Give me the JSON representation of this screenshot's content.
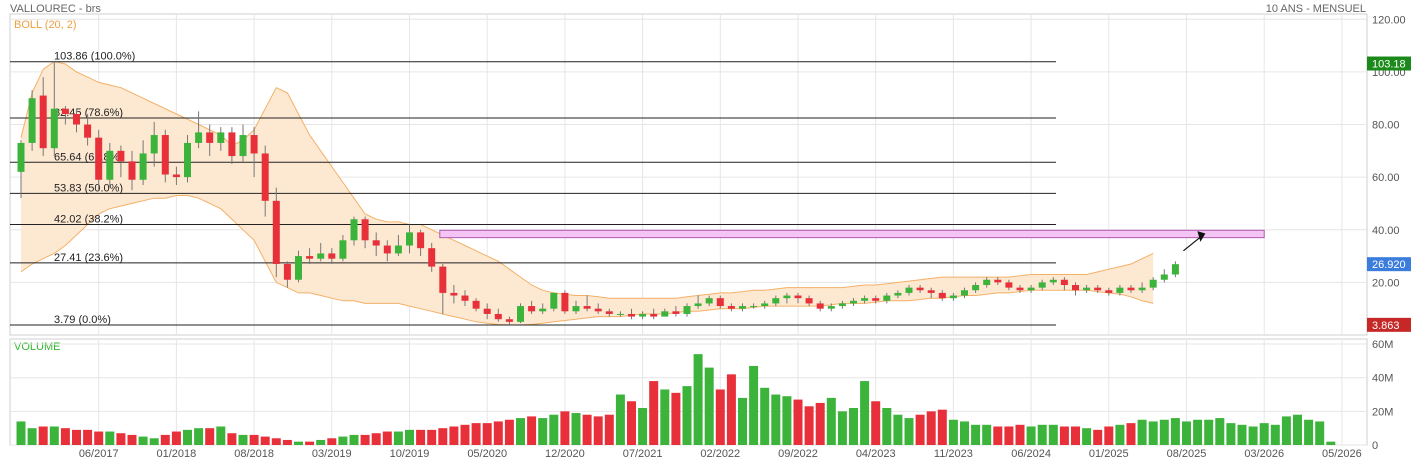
{
  "header": {
    "title": "VALLOUREC - brs",
    "period": "10 ANS - MENSUEL",
    "indicator": "BOLL (20, 2)",
    "volume_label": "VOLUME"
  },
  "colors": {
    "up": "#3cb43c",
    "down": "#e8303a",
    "band_fill": "#fde9d2",
    "band_line": "#f3b067",
    "grid": "#e6e6e6",
    "zone_fill": "#f4c4f4",
    "zone_border": "#b05ab0",
    "high_badge": "#1b8a1b",
    "last_badge": "#3b7ddd",
    "low_badge": "#c62828"
  },
  "chart_data": {
    "type": "candlestick",
    "price_axis": {
      "ticks": [
        "120.00",
        "100.00",
        "80.00",
        "60.00",
        "40.00",
        "20.00"
      ],
      "values": [
        120,
        100,
        80,
        60,
        40,
        20
      ],
      "range": [
        0,
        122
      ]
    },
    "volume_axis": {
      "ticks": [
        "60M",
        "40M",
        "20M",
        "0"
      ],
      "values": [
        60,
        40,
        20,
        0
      ],
      "range": [
        0,
        63
      ]
    },
    "x_labels": [
      "06/2017",
      "01/2018",
      "08/2018",
      "03/2019",
      "10/2019",
      "05/2020",
      "12/2020",
      "07/2021",
      "02/2022",
      "09/2022",
      "04/2023",
      "11/2023",
      "06/2024",
      "01/2025",
      "08/2025",
      "03/2026",
      "05/2026"
    ],
    "x_label_index": [
      7,
      14,
      21,
      28,
      35,
      42,
      49,
      56,
      63,
      70,
      77,
      84,
      91,
      98,
      105,
      112,
      119
    ],
    "fib_levels": [
      {
        "label": "103.86  (100.0%)",
        "price": 103.86
      },
      {
        "label": "82.45  (78.6%)",
        "price": 82.45
      },
      {
        "label": "65.64  (61.8%)",
        "price": 65.64
      },
      {
        "label": "53.83  (50.0%)",
        "price": 53.83
      },
      {
        "label": "42.02  (38.2%)",
        "price": 42.02
      },
      {
        "label": "27.41  (23.6%)",
        "price": 27.41
      },
      {
        "label": "3.79  (0.0%)",
        "price": 3.79
      }
    ],
    "badges": [
      {
        "label": "103.18",
        "price": 103.18,
        "kind": "high"
      },
      {
        "label": "26.920",
        "price": 26.92,
        "kind": "last"
      },
      {
        "label": "3.863",
        "price": 3.863,
        "kind": "low"
      }
    ],
    "resistance_zone": {
      "low": 37.0,
      "high": 39.8,
      "from_index": 38,
      "to_index": 112
    },
    "candles": [
      [
        62,
        73,
        52,
        74
      ],
      [
        73,
        90,
        70,
        93
      ],
      [
        91,
        71,
        68,
        98
      ],
      [
        71,
        86,
        68,
        104
      ],
      [
        86,
        84,
        80,
        87
      ],
      [
        84,
        80,
        77,
        86
      ],
      [
        80,
        75,
        72,
        84
      ],
      [
        75,
        59,
        55,
        78
      ],
      [
        59,
        70,
        56,
        73
      ],
      [
        70,
        66,
        60,
        72
      ],
      [
        66,
        59,
        55,
        70
      ],
      [
        59,
        69,
        57,
        74
      ],
      [
        69,
        76,
        64,
        81
      ],
      [
        76,
        61,
        58,
        78
      ],
      [
        61,
        60,
        57,
        64
      ],
      [
        60,
        73,
        58,
        76
      ],
      [
        73,
        77,
        71,
        85
      ],
      [
        77,
        73,
        68,
        80
      ],
      [
        73,
        77,
        70,
        79
      ],
      [
        77,
        68,
        65,
        79
      ],
      [
        68,
        76,
        66,
        80
      ],
      [
        76,
        69,
        60,
        79
      ],
      [
        69,
        51,
        45,
        72
      ],
      [
        51,
        27,
        22,
        56
      ],
      [
        27,
        21,
        18,
        28
      ],
      [
        21,
        30,
        20,
        32
      ],
      [
        30,
        29,
        27,
        33
      ],
      [
        29,
        31,
        28,
        35
      ],
      [
        31,
        29,
        27,
        33
      ],
      [
        29,
        36,
        28,
        38
      ],
      [
        36,
        44,
        34,
        45
      ],
      [
        44,
        36,
        33,
        45
      ],
      [
        36,
        34,
        30,
        39
      ],
      [
        34,
        31,
        28,
        36
      ],
      [
        31,
        34,
        30,
        38
      ],
      [
        34,
        39,
        31,
        42
      ],
      [
        39,
        33,
        30,
        40
      ],
      [
        33,
        26,
        24,
        35
      ],
      [
        26,
        16,
        8,
        27
      ],
      [
        16,
        15,
        12,
        19
      ],
      [
        15,
        13,
        11,
        17
      ],
      [
        13,
        10,
        9,
        14
      ],
      [
        10,
        8,
        6,
        12
      ],
      [
        8,
        6,
        5,
        10
      ],
      [
        6,
        5,
        3.9,
        7
      ],
      [
        5,
        11,
        4.5,
        12
      ],
      [
        11,
        9,
        8,
        13
      ],
      [
        9,
        10,
        8,
        12
      ],
      [
        10,
        16,
        9,
        16
      ],
      [
        16,
        9,
        8,
        17
      ],
      [
        9,
        11,
        8,
        13
      ],
      [
        11,
        10,
        9,
        15
      ],
      [
        10,
        9,
        8,
        12
      ],
      [
        9,
        8,
        7,
        10
      ],
      [
        8,
        8,
        7,
        9
      ],
      [
        8,
        7,
        6,
        10
      ],
      [
        7,
        8,
        6,
        9
      ],
      [
        8,
        7,
        6,
        10
      ],
      [
        7,
        9,
        7,
        10
      ],
      [
        9,
        8,
        7,
        11
      ],
      [
        8,
        11,
        7,
        12
      ],
      [
        11,
        12,
        10,
        15
      ],
      [
        12,
        14,
        11,
        15
      ],
      [
        14,
        11,
        10,
        15
      ],
      [
        11,
        10,
        9,
        12
      ],
      [
        10,
        11,
        9,
        12
      ],
      [
        11,
        11,
        10,
        12
      ],
      [
        11,
        12,
        10,
        13
      ],
      [
        12,
        14,
        11,
        15
      ],
      [
        14,
        15,
        12,
        16
      ],
      [
        15,
        14,
        12,
        16
      ],
      [
        14,
        12,
        11,
        15
      ],
      [
        12,
        10,
        9,
        13
      ],
      [
        10,
        11,
        9,
        12
      ],
      [
        11,
        12,
        10,
        13
      ],
      [
        12,
        13,
        11,
        14
      ],
      [
        13,
        14,
        12,
        15
      ],
      [
        14,
        13,
        12,
        15
      ],
      [
        13,
        15,
        12,
        16
      ],
      [
        15,
        16,
        14,
        17
      ],
      [
        16,
        18,
        15,
        19
      ],
      [
        18,
        17,
        16,
        19
      ],
      [
        17,
        16,
        14,
        18
      ],
      [
        16,
        14,
        13,
        17
      ],
      [
        14,
        15,
        13,
        16
      ],
      [
        15,
        17,
        14,
        18
      ],
      [
        17,
        19,
        16,
        20
      ],
      [
        19,
        21,
        18,
        22
      ],
      [
        21,
        20,
        19,
        22
      ],
      [
        20,
        18,
        17,
        21
      ],
      [
        18,
        17,
        16,
        19
      ],
      [
        17,
        18,
        16,
        19
      ],
      [
        18,
        20,
        17,
        21
      ],
      [
        20,
        21,
        19,
        22
      ],
      [
        21,
        19,
        17,
        22
      ],
      [
        19,
        17,
        15,
        20
      ],
      [
        17,
        18,
        16,
        19
      ],
      [
        18,
        17,
        16,
        19
      ],
      [
        17,
        16,
        15,
        18
      ],
      [
        16,
        18,
        15,
        19
      ],
      [
        18,
        17,
        16,
        19
      ],
      [
        17,
        18,
        16,
        20
      ],
      [
        18,
        21,
        17,
        22
      ],
      [
        21,
        23,
        20,
        25
      ],
      [
        23,
        26.92,
        22,
        28
      ]
    ],
    "band_upper": [
      75,
      92,
      101,
      104,
      103,
      100,
      98,
      96,
      95,
      94,
      92,
      90,
      88,
      86,
      84,
      82,
      80,
      78,
      76,
      72,
      74,
      78,
      86,
      94,
      92,
      84,
      76,
      70,
      64,
      58,
      52,
      46,
      44,
      43,
      43,
      42,
      42,
      40,
      38,
      36,
      34,
      32,
      30,
      28,
      25,
      22,
      19,
      17,
      16,
      15.5,
      15,
      15,
      14.5,
      14,
      14,
      14,
      14,
      14,
      14,
      14,
      14.5,
      15,
      15.5,
      16,
      16,
      16.5,
      17,
      17,
      17.5,
      18,
      18,
      18,
      18,
      18,
      18,
      18.5,
      19,
      19,
      19.5,
      20,
      20.5,
      21,
      21.5,
      22,
      22,
      22,
      22,
      22,
      22,
      22,
      22.5,
      23,
      23,
      23,
      23,
      23,
      23,
      24,
      25,
      26,
      27,
      29,
      31
    ],
    "band_lower": [
      24,
      27,
      29,
      31,
      34,
      38,
      42,
      46,
      48,
      49,
      50,
      51,
      52,
      52,
      53,
      53,
      52,
      50,
      48,
      44,
      40,
      36,
      28,
      20,
      18,
      16,
      16,
      15,
      14,
      13,
      13,
      12,
      12,
      12,
      12,
      11,
      10,
      9,
      8,
      7,
      6,
      5,
      4.5,
      4,
      3.8,
      3.8,
      4,
      4.5,
      5,
      5.5,
      6,
      6.5,
      7,
      7,
      7,
      7.5,
      8,
      8,
      8,
      8.5,
      9,
      9,
      9.5,
      10,
      10,
      10,
      10.5,
      11,
      11,
      11,
      11,
      11,
      11,
      11.5,
      12,
      12,
      12,
      12.5,
      13,
      13,
      13,
      13.5,
      14,
      14,
      14.5,
      15,
      15,
      15.5,
      16,
      16,
      16.5,
      17,
      17,
      17,
      17,
      17,
      17,
      16.5,
      16,
      15.5,
      14.5,
      13,
      12
    ],
    "volumes": [
      14,
      10,
      11,
      11,
      10,
      9,
      9,
      8,
      8,
      7,
      6,
      5,
      4,
      6,
      8,
      9,
      10,
      10,
      11,
      7,
      6,
      6,
      5,
      4,
      3,
      2,
      2,
      3,
      4,
      5,
      6,
      6,
      7,
      8,
      8,
      9,
      9,
      9,
      10,
      11,
      12,
      13,
      13,
      14,
      15,
      16,
      17,
      16,
      18,
      20,
      19,
      18,
      17,
      18,
      30,
      26,
      22,
      38,
      33,
      31,
      35,
      54,
      46,
      33,
      42,
      28,
      47,
      34,
      30,
      29,
      27,
      23,
      25,
      28,
      20,
      22,
      38,
      26,
      22,
      18,
      16,
      18,
      20,
      21,
      15,
      14,
      12,
      12,
      11,
      11,
      12,
      11,
      12,
      12,
      11,
      11,
      10,
      9,
      11,
      12,
      13,
      15,
      14,
      15,
      16,
      14,
      15,
      15,
      16,
      13,
      12,
      11,
      13,
      12,
      17,
      18,
      15,
      14,
      2
    ]
  }
}
